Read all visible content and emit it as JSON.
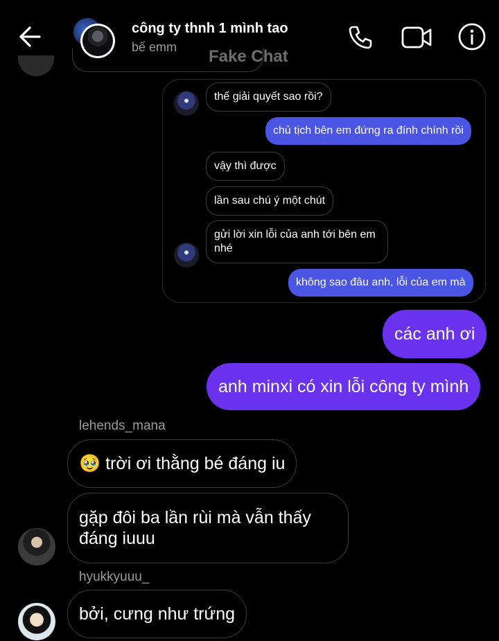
{
  "header": {
    "title": "công ty thnh 1 mình tao",
    "subtitle": "bế emm",
    "watermark": "Fake Chat",
    "icons": {
      "back": "arrow-left-icon",
      "call": "phone-icon",
      "video": "video-camera-icon",
      "info": "info-circle-icon"
    }
  },
  "embedded_chat": {
    "messages": [
      {
        "direction": "in",
        "text": "thế giải quyết sao rồi?"
      },
      {
        "direction": "out",
        "text": "chủ tịch bên em đứng ra đính chính rồi"
      },
      {
        "direction": "in",
        "text": "vậy thì được"
      },
      {
        "direction": "in",
        "text": "lần sau chú ý một chút"
      },
      {
        "direction": "in",
        "text": "gửi lời xin lỗi của anh tới bên em nhé"
      },
      {
        "direction": "out",
        "text": "không sao đâu anh, lỗi của em mà"
      }
    ]
  },
  "messages": [
    {
      "direction": "out",
      "text": "các anh ơi"
    },
    {
      "direction": "out",
      "text": "anh minxi có xin lỗi công ty mình"
    },
    {
      "direction": "in",
      "sender": "lehends_mana",
      "text": "🥹 trời ơi thằng bé đáng iu"
    },
    {
      "direction": "in",
      "text": "gặp đôi ba lần rùi mà vẫn thấy đáng iuuu"
    },
    {
      "direction": "in",
      "sender": "hyukkyuuu_",
      "text": "bởi, cưng như trứng"
    }
  ],
  "colors": {
    "background": "#000000",
    "outgoing_bubble": "#6a32ee",
    "embedded_outgoing_bubble": "#4a55e3",
    "incoming_border": "#3c3c3c",
    "secondary_text": "#9a9a9a"
  }
}
